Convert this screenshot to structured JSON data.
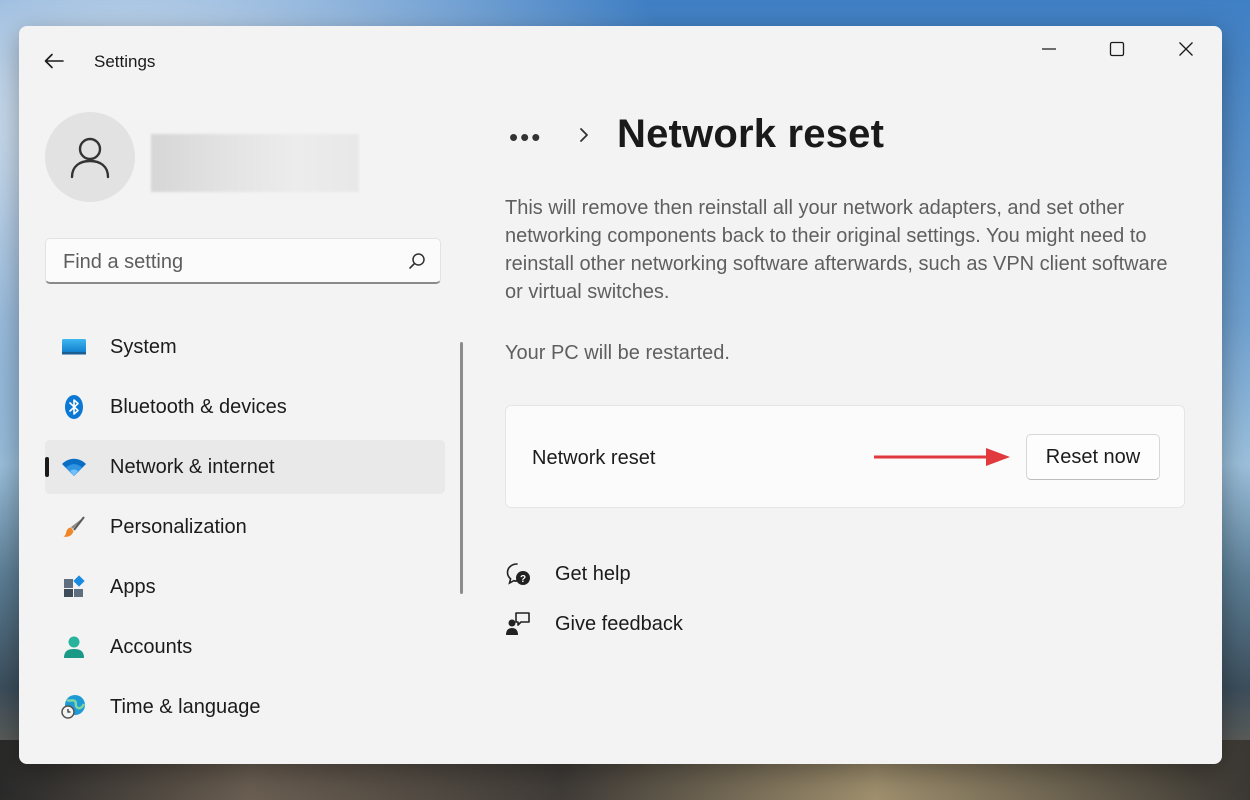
{
  "window": {
    "app_title": "Settings"
  },
  "search": {
    "placeholder": "Find a setting"
  },
  "sidebar": {
    "items": [
      {
        "label": "System",
        "icon": "system-icon"
      },
      {
        "label": "Bluetooth & devices",
        "icon": "bluetooth-icon"
      },
      {
        "label": "Network & internet",
        "icon": "wifi-icon",
        "selected": true
      },
      {
        "label": "Personalization",
        "icon": "brush-icon"
      },
      {
        "label": "Apps",
        "icon": "apps-icon"
      },
      {
        "label": "Accounts",
        "icon": "accounts-icon"
      },
      {
        "label": "Time & language",
        "icon": "time-language-icon"
      }
    ]
  },
  "main": {
    "breadcrumb_more": "•••",
    "title": "Network reset",
    "description": "This will remove then reinstall all your network adapters, and set other networking components back to their original settings. You might need to reinstall other networking software afterwards, such as VPN client software or virtual switches.",
    "restart_note": "Your PC will be restarted.",
    "reset_card": {
      "label": "Network reset",
      "button_label": "Reset now"
    },
    "links": {
      "get_help": "Get help",
      "give_feedback": "Give feedback"
    }
  },
  "colors": {
    "accent": "#0067c0",
    "annotation_arrow": "#e0393e",
    "window_bg": "#f3f3f3"
  }
}
